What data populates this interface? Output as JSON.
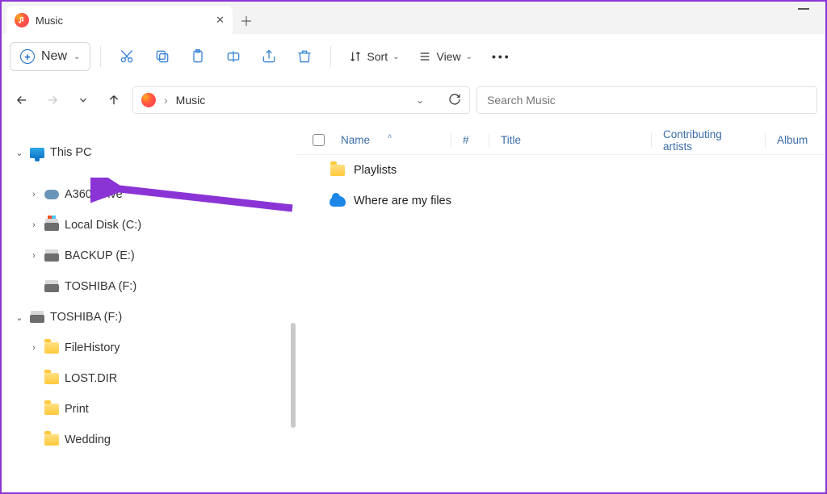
{
  "tab": {
    "title": "Music"
  },
  "toolbar": {
    "new_label": "New",
    "sort_label": "Sort",
    "view_label": "View"
  },
  "address": {
    "path": "Music"
  },
  "search": {
    "placeholder": "Search Music"
  },
  "columns": {
    "name": "Name",
    "num": "#",
    "title": "Title",
    "contributing": "Contributing artists",
    "album": "Album"
  },
  "files": [
    {
      "name": "Playlists",
      "icon": "folder"
    },
    {
      "name": "Where are my files",
      "icon": "onedrive"
    }
  ],
  "sidebar": {
    "this_pc": "This PC",
    "items": [
      {
        "label": "A360 Drive",
        "icon": "cloud",
        "expandable": true
      },
      {
        "label": "Local Disk (C:)",
        "icon": "drive-win",
        "expandable": true
      },
      {
        "label": "BACKUP (E:)",
        "icon": "drive",
        "expandable": true
      },
      {
        "label": "TOSHIBA (F:)",
        "icon": "drive",
        "expandable": false
      },
      {
        "label": "TOSHIBA (F:)",
        "icon": "drive",
        "expandable": true,
        "expanded": true,
        "level": 0
      },
      {
        "label": "FileHistory",
        "icon": "folder",
        "expandable": true,
        "level": 1
      },
      {
        "label": "LOST.DIR",
        "icon": "folder",
        "expandable": false,
        "level": 1
      },
      {
        "label": "Print",
        "icon": "folder",
        "expandable": false,
        "level": 1
      },
      {
        "label": "Wedding",
        "icon": "folder",
        "expandable": false,
        "level": 1
      }
    ]
  }
}
